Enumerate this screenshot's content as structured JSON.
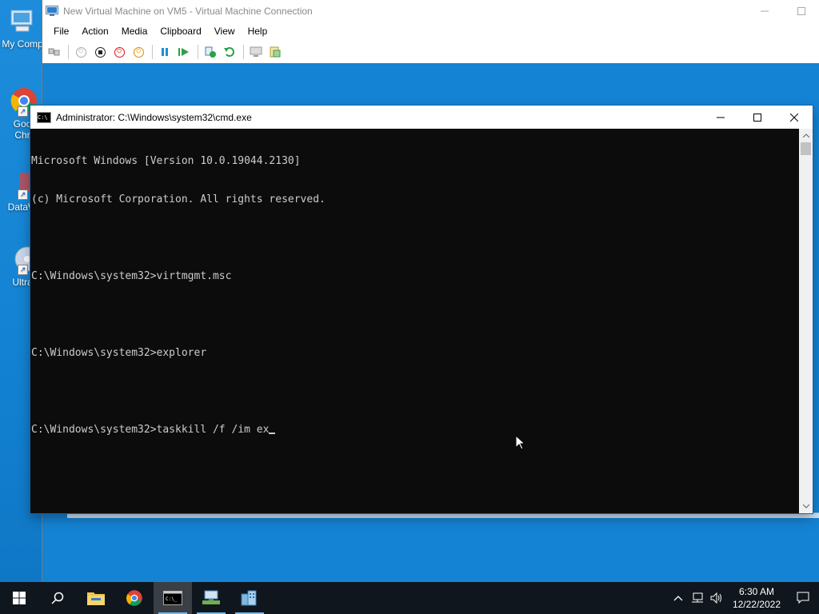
{
  "desktop": {
    "icons": [
      {
        "label": "My Comp",
        "icon": "computer-icon"
      },
      {
        "label": "Goo\nChr",
        "icon": "chrome-icon"
      },
      {
        "label": "DataW",
        "icon": "datawrapper-icon"
      },
      {
        "label": "Ultra",
        "icon": "disc-icon"
      }
    ]
  },
  "vm_window": {
    "title": "New Virtual Machine on VM5 - Virtual Machine Connection",
    "menu": [
      "File",
      "Action",
      "Media",
      "Clipboard",
      "View",
      "Help"
    ],
    "toolbar": [
      "ctrl-alt-del-icon",
      "start-icon",
      "turn-off-icon",
      "shutdown-icon",
      "save-icon",
      "pause-icon",
      "resume-icon",
      "checkpoint-icon",
      "revert-icon",
      "enhanced-session-icon",
      "share-icon"
    ]
  },
  "cmd_window": {
    "title": "Administrator: C:\\Windows\\system32\\cmd.exe",
    "lines": [
      "Microsoft Windows [Version 10.0.19044.2130]",
      "(c) Microsoft Corporation. All rights reserved.",
      "",
      "C:\\Windows\\system32>virtmgmt.msc",
      "",
      "C:\\Windows\\system32>explorer",
      "",
      "C:\\Windows\\system32>taskkill /f /im ex"
    ]
  },
  "taskbar": {
    "items": [
      "start-icon",
      "search-icon",
      "file-explorer-icon",
      "chrome-icon",
      "cmd-icon",
      "network-manager-icon",
      "hyperv-icon"
    ],
    "clock": {
      "time": "6:30 AM",
      "date": "12/22/2022"
    },
    "colors": {
      "accent": "#76b9ed",
      "background": "#10161d"
    }
  }
}
